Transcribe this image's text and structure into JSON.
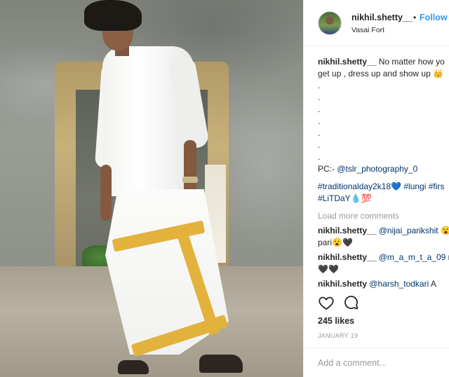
{
  "post": {
    "username": "nikhil.shetty__",
    "separator": "•",
    "follow_label": "Follow",
    "location": "Vasai Fort"
  },
  "caption": {
    "username": "nikhil.shetty__",
    "text_line1": "No matter how yo",
    "text_line2": "get up , dress up and show up 👑",
    "dots": [
      ".",
      ".",
      ".",
      ".",
      ".",
      ".",
      "."
    ],
    "credit_prefix": "PC:- ",
    "credit_handle": "@tslr_photography_0",
    "hashtags_line1": "#traditionalday2k18💙 #lungi #firs",
    "hashtags_line2": "#LiTDaY💧💯"
  },
  "load_more": "Load more comments",
  "comments": [
    {
      "username": "nikhil.shetty__",
      "mention": "@nijai_parikshit",
      "trail": " 😮",
      "line2": "pari😮🖤"
    },
    {
      "username": "nikhil.shetty__",
      "mention": "@m_a_m_t_a_09",
      "trail": " n",
      "line2": "🖤🖤"
    },
    {
      "username": "nikhil.shetty",
      "mention": "@harsh_todkari",
      "trail": " A"
    }
  ],
  "actions": {
    "like_icon": "heart-icon",
    "comment_icon": "comment-bubble-icon"
  },
  "likes": "245 likes",
  "date": "JANUARY 19",
  "add_comment_placeholder": "Add a comment..."
}
